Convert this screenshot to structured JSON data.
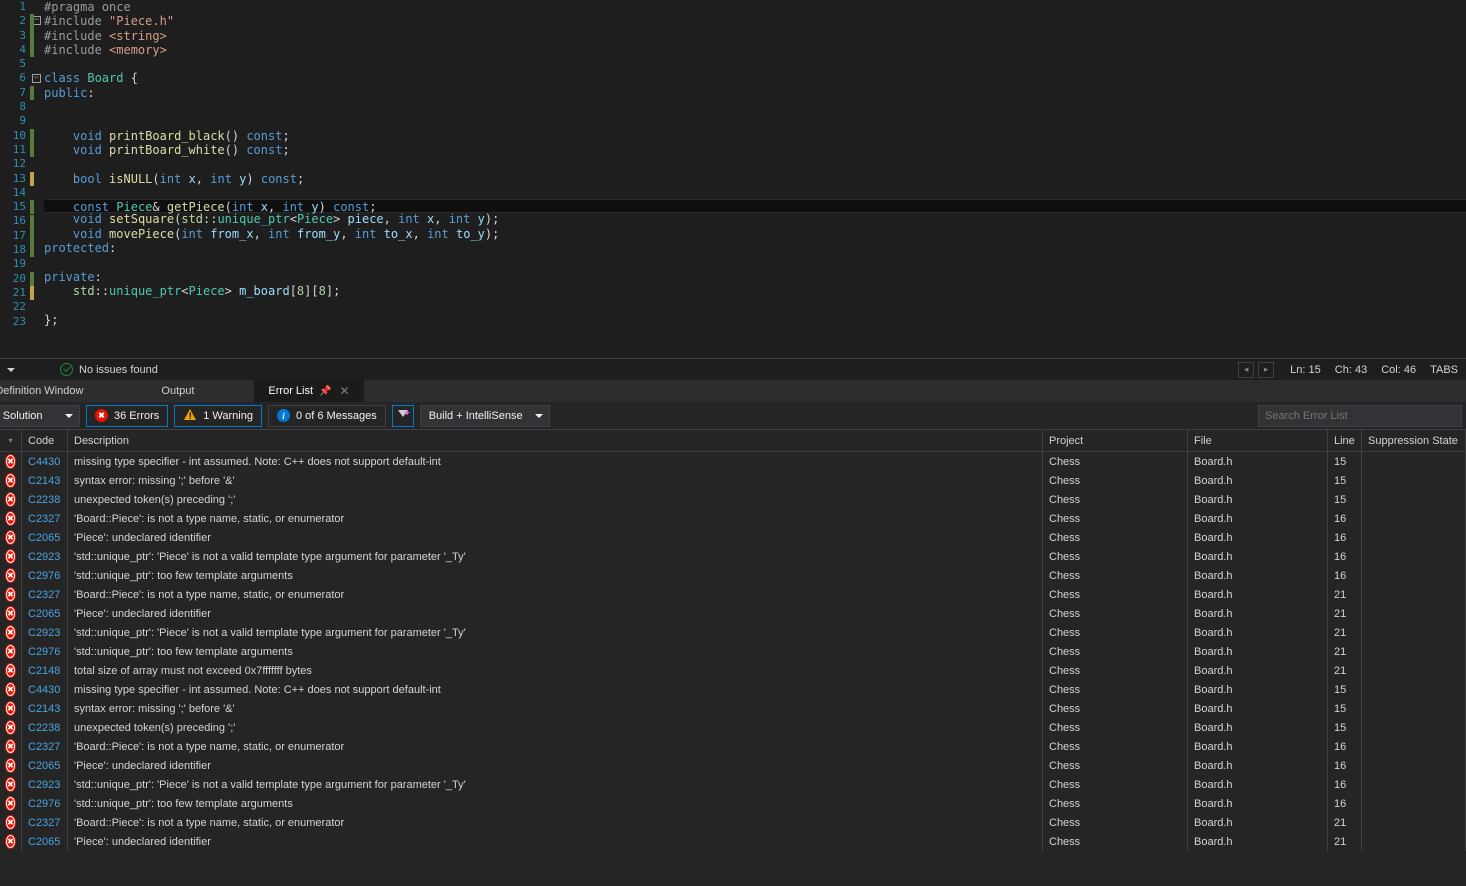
{
  "editor": {
    "lines": [
      {
        "n": 1,
        "tokens": [
          [
            "tk-pp",
            "#pragma"
          ],
          [
            "tk-op",
            " "
          ],
          [
            "tk-pp",
            "once"
          ]
        ]
      },
      {
        "n": 2,
        "fold": "minus",
        "bar": "green",
        "tokens": [
          [
            "tk-inc",
            "#include "
          ],
          [
            "tk-str",
            "\"Piece.h\""
          ]
        ]
      },
      {
        "n": 3,
        "bar": "green",
        "tokens": [
          [
            "tk-inc",
            "#include "
          ],
          [
            "tk-str",
            "<string>"
          ]
        ]
      },
      {
        "n": 4,
        "bar": "green",
        "tokens": [
          [
            "tk-inc",
            "#include "
          ],
          [
            "tk-str",
            "<memory>"
          ]
        ]
      },
      {
        "n": 5,
        "tokens": []
      },
      {
        "n": 6,
        "fold": "minus",
        "tokens": [
          [
            "tk-kw",
            "class"
          ],
          [
            "tk-op",
            " "
          ],
          [
            "tk-type",
            "Board"
          ],
          [
            "tk-op",
            " {"
          ]
        ]
      },
      {
        "n": 7,
        "bar": "green",
        "tokens": [
          [
            "tk-kw",
            "public"
          ],
          [
            "tk-punc",
            ":"
          ]
        ]
      },
      {
        "n": 8,
        "tokens": []
      },
      {
        "n": 9,
        "tokens": []
      },
      {
        "n": 10,
        "bar": "green",
        "tokens": [
          [
            "tk-op",
            "    "
          ],
          [
            "tk-kw",
            "void"
          ],
          [
            "tk-op",
            " "
          ],
          [
            "tk-func",
            "printBoard_black"
          ],
          [
            "tk-punc",
            "() "
          ],
          [
            "tk-kw",
            "const"
          ],
          [
            "tk-punc",
            ";"
          ]
        ]
      },
      {
        "n": 11,
        "bar": "green",
        "tokens": [
          [
            "tk-op",
            "    "
          ],
          [
            "tk-kw",
            "void"
          ],
          [
            "tk-op",
            " "
          ],
          [
            "tk-func",
            "printBoard_white"
          ],
          [
            "tk-punc",
            "() "
          ],
          [
            "tk-kw",
            "const"
          ],
          [
            "tk-punc",
            ";"
          ]
        ]
      },
      {
        "n": 12,
        "tokens": []
      },
      {
        "n": 13,
        "bar": "yellow",
        "tokens": [
          [
            "tk-op",
            "    "
          ],
          [
            "tk-kw",
            "bool"
          ],
          [
            "tk-op",
            " "
          ],
          [
            "tk-func",
            "isNULL"
          ],
          [
            "tk-punc",
            "("
          ],
          [
            "tk-kw",
            "int"
          ],
          [
            "tk-op",
            " "
          ],
          [
            "tk-var",
            "x"
          ],
          [
            "tk-punc",
            ", "
          ],
          [
            "tk-kw",
            "int"
          ],
          [
            "tk-op",
            " "
          ],
          [
            "tk-var",
            "y"
          ],
          [
            "tk-punc",
            ") "
          ],
          [
            "tk-kw",
            "const"
          ],
          [
            "tk-punc",
            ";"
          ]
        ]
      },
      {
        "n": 14,
        "tokens": []
      },
      {
        "n": 15,
        "highlight": true,
        "bar": "green",
        "tokens": [
          [
            "tk-op",
            "    "
          ],
          [
            "tk-kw",
            "const"
          ],
          [
            "tk-op",
            " "
          ],
          [
            "tk-type",
            "Piece"
          ],
          [
            "tk-op",
            "& "
          ],
          [
            "tk-func",
            "getPiece"
          ],
          [
            "tk-punc",
            "("
          ],
          [
            "tk-kw",
            "int"
          ],
          [
            "tk-op",
            " "
          ],
          [
            "tk-var",
            "x"
          ],
          [
            "tk-punc",
            ", "
          ],
          [
            "tk-kw",
            "int"
          ],
          [
            "tk-op",
            " "
          ],
          [
            "tk-var",
            "y"
          ],
          [
            "tk-punc",
            ") "
          ],
          [
            "tk-kw",
            "const"
          ],
          [
            "tk-punc",
            ";"
          ]
        ]
      },
      {
        "n": 16,
        "bar": "green",
        "tokens": [
          [
            "tk-op",
            "    "
          ],
          [
            "tk-kw",
            "void"
          ],
          [
            "tk-op",
            " "
          ],
          [
            "tk-func",
            "setSquare"
          ],
          [
            "tk-punc",
            "("
          ],
          [
            "tk-ns",
            "std"
          ],
          [
            "tk-punc",
            "::"
          ],
          [
            "tk-type",
            "unique_ptr"
          ],
          [
            "tk-punc",
            "<"
          ],
          [
            "tk-type",
            "Piece"
          ],
          [
            "tk-punc",
            "> "
          ],
          [
            "tk-var",
            "piece"
          ],
          [
            "tk-punc",
            ", "
          ],
          [
            "tk-kw",
            "int"
          ],
          [
            "tk-op",
            " "
          ],
          [
            "tk-var",
            "x"
          ],
          [
            "tk-punc",
            ", "
          ],
          [
            "tk-kw",
            "int"
          ],
          [
            "tk-op",
            " "
          ],
          [
            "tk-var",
            "y"
          ],
          [
            "tk-punc",
            ");"
          ]
        ]
      },
      {
        "n": 17,
        "bar": "green",
        "tokens": [
          [
            "tk-op",
            "    "
          ],
          [
            "tk-kw",
            "void"
          ],
          [
            "tk-op",
            " "
          ],
          [
            "tk-func",
            "movePiece"
          ],
          [
            "tk-punc",
            "("
          ],
          [
            "tk-kw",
            "int"
          ],
          [
            "tk-op",
            " "
          ],
          [
            "tk-var",
            "from_x"
          ],
          [
            "tk-punc",
            ", "
          ],
          [
            "tk-kw",
            "int"
          ],
          [
            "tk-op",
            " "
          ],
          [
            "tk-var",
            "from_y"
          ],
          [
            "tk-punc",
            ", "
          ],
          [
            "tk-kw",
            "int"
          ],
          [
            "tk-op",
            " "
          ],
          [
            "tk-var",
            "to_x"
          ],
          [
            "tk-punc",
            ", "
          ],
          [
            "tk-kw",
            "int"
          ],
          [
            "tk-op",
            " "
          ],
          [
            "tk-var",
            "to_y"
          ],
          [
            "tk-punc",
            ");"
          ]
        ]
      },
      {
        "n": 18,
        "bar": "green",
        "tokens": [
          [
            "tk-kw",
            "protected"
          ],
          [
            "tk-punc",
            ":"
          ]
        ]
      },
      {
        "n": 19,
        "tokens": []
      },
      {
        "n": 20,
        "bar": "green",
        "tokens": [
          [
            "tk-kw",
            "private"
          ],
          [
            "tk-punc",
            ":"
          ]
        ]
      },
      {
        "n": 21,
        "bar": "yellow",
        "tokens": [
          [
            "tk-op",
            "    "
          ],
          [
            "tk-ns",
            "std"
          ],
          [
            "tk-punc",
            "::"
          ],
          [
            "tk-type",
            "unique_ptr"
          ],
          [
            "tk-punc",
            "<"
          ],
          [
            "tk-type",
            "Piece"
          ],
          [
            "tk-punc",
            "> "
          ],
          [
            "tk-var",
            "m_board"
          ],
          [
            "tk-punc",
            "["
          ],
          [
            "tk-lit",
            "8"
          ],
          [
            "tk-punc",
            "]["
          ],
          [
            "tk-lit",
            "8"
          ],
          [
            "tk-punc",
            "];"
          ]
        ]
      },
      {
        "n": 22,
        "tokens": []
      },
      {
        "n": 23,
        "tokens": [
          [
            "tk-punc",
            "};"
          ]
        ]
      }
    ]
  },
  "status": {
    "no_issues": "No issues found",
    "ln_label": "Ln:",
    "ln": "15",
    "ch_label": "Ch:",
    "ch": "43",
    "col_label": "Col:",
    "col": "46",
    "tabs": "TABS"
  },
  "tabs": {
    "code_def": "Code Definition Window",
    "output": "Output",
    "error_list": "Error List"
  },
  "toolbar": {
    "scope": "Entire Solution",
    "errors_count": "36 Errors",
    "warnings_count": "1 Warning",
    "messages_count": "0 of 6 Messages",
    "source": "Build + IntelliSense",
    "search_placeholder": "Search Error List"
  },
  "headers": {
    "code": "Code",
    "description": "Description",
    "project": "Project",
    "file": "File",
    "line": "Line",
    "suppression": "Suppression State"
  },
  "errors": [
    {
      "sev": "err",
      "code": "C4430",
      "desc": "missing type specifier - int assumed. Note: C++ does not support default-int",
      "proj": "Chess",
      "file": "Board.h",
      "line": "15"
    },
    {
      "sev": "err",
      "code": "C2143",
      "desc": "syntax error: missing ';' before '&'",
      "proj": "Chess",
      "file": "Board.h",
      "line": "15"
    },
    {
      "sev": "err",
      "code": "C2238",
      "desc": "unexpected token(s) preceding ';'",
      "proj": "Chess",
      "file": "Board.h",
      "line": "15"
    },
    {
      "sev": "err",
      "code": "C2327",
      "desc": "'Board::Piece': is not a type name, static, or enumerator",
      "proj": "Chess",
      "file": "Board.h",
      "line": "16"
    },
    {
      "sev": "err",
      "code": "C2065",
      "desc": "'Piece': undeclared identifier",
      "proj": "Chess",
      "file": "Board.h",
      "line": "16"
    },
    {
      "sev": "err",
      "code": "C2923",
      "desc": "'std::unique_ptr': 'Piece' is not a valid template type argument for parameter '_Ty'",
      "proj": "Chess",
      "file": "Board.h",
      "line": "16"
    },
    {
      "sev": "err",
      "code": "C2976",
      "desc": "'std::unique_ptr': too few template arguments",
      "proj": "Chess",
      "file": "Board.h",
      "line": "16"
    },
    {
      "sev": "err",
      "code": "C2327",
      "desc": "'Board::Piece': is not a type name, static, or enumerator",
      "proj": "Chess",
      "file": "Board.h",
      "line": "21"
    },
    {
      "sev": "err",
      "code": "C2065",
      "desc": "'Piece': undeclared identifier",
      "proj": "Chess",
      "file": "Board.h",
      "line": "21"
    },
    {
      "sev": "err",
      "code": "C2923",
      "desc": "'std::unique_ptr': 'Piece' is not a valid template type argument for parameter '_Ty'",
      "proj": "Chess",
      "file": "Board.h",
      "line": "21"
    },
    {
      "sev": "err",
      "code": "C2976",
      "desc": "'std::unique_ptr': too few template arguments",
      "proj": "Chess",
      "file": "Board.h",
      "line": "21"
    },
    {
      "sev": "err",
      "code": "C2148",
      "desc": "total size of array must not exceed 0x7fffffff bytes",
      "proj": "Chess",
      "file": "Board.h",
      "line": "21"
    },
    {
      "sev": "err",
      "code": "C4430",
      "desc": "missing type specifier - int assumed. Note: C++ does not support default-int",
      "proj": "Chess",
      "file": "Board.h",
      "line": "15"
    },
    {
      "sev": "err",
      "code": "C2143",
      "desc": "syntax error: missing ';' before '&'",
      "proj": "Chess",
      "file": "Board.h",
      "line": "15"
    },
    {
      "sev": "err",
      "code": "C2238",
      "desc": "unexpected token(s) preceding ';'",
      "proj": "Chess",
      "file": "Board.h",
      "line": "15"
    },
    {
      "sev": "err",
      "code": "C2327",
      "desc": "'Board::Piece': is not a type name, static, or enumerator",
      "proj": "Chess",
      "file": "Board.h",
      "line": "16"
    },
    {
      "sev": "err",
      "code": "C2065",
      "desc": "'Piece': undeclared identifier",
      "proj": "Chess",
      "file": "Board.h",
      "line": "16"
    },
    {
      "sev": "err",
      "code": "C2923",
      "desc": "'std::unique_ptr': 'Piece' is not a valid template type argument for parameter '_Ty'",
      "proj": "Chess",
      "file": "Board.h",
      "line": "16"
    },
    {
      "sev": "err",
      "code": "C2976",
      "desc": "'std::unique_ptr': too few template arguments",
      "proj": "Chess",
      "file": "Board.h",
      "line": "16"
    },
    {
      "sev": "err",
      "code": "C2327",
      "desc": "'Board::Piece': is not a type name, static, or enumerator",
      "proj": "Chess",
      "file": "Board.h",
      "line": "21"
    },
    {
      "sev": "err",
      "code": "C2065",
      "desc": "'Piece': undeclared identifier",
      "proj": "Chess",
      "file": "Board.h",
      "line": "21"
    }
  ]
}
